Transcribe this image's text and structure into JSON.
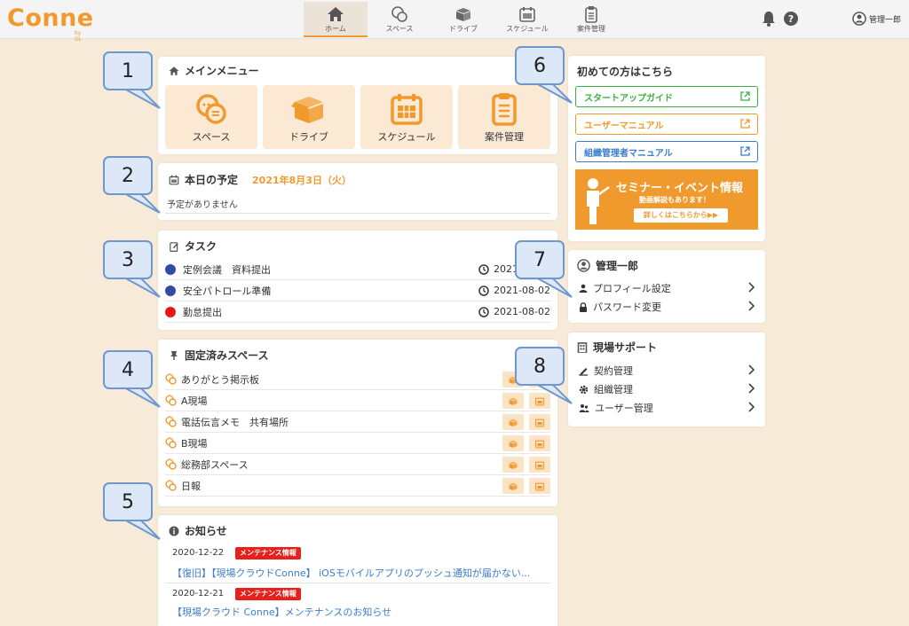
{
  "header": {
    "logo": "Conne",
    "logo_sub": "by GL",
    "nav": [
      {
        "label": "ホーム",
        "icon": "home-icon"
      },
      {
        "label": "スペース",
        "icon": "chat-icon"
      },
      {
        "label": "ドライブ",
        "icon": "box-icon"
      },
      {
        "label": "スケジュール",
        "icon": "calendar-icon"
      },
      {
        "label": "案件管理",
        "icon": "clipboard-icon"
      }
    ],
    "user": "管理一郎"
  },
  "main_menu": {
    "title": "メインメニュー",
    "tiles": [
      {
        "label": "スペース",
        "icon": "chat-icon"
      },
      {
        "label": "ドライブ",
        "icon": "box-icon"
      },
      {
        "label": "スケジュール",
        "icon": "calendar-icon"
      },
      {
        "label": "案件管理",
        "icon": "clipboard-icon"
      }
    ]
  },
  "today": {
    "title": "本日の予定",
    "date": "2021年8月3日（火）",
    "empty": "予定がありません"
  },
  "tasks": {
    "title": "タスク",
    "items": [
      {
        "label": "定例会議　資料提出",
        "due": "2021",
        "color": "#2f4ba3"
      },
      {
        "label": "安全パトロール準備",
        "due": "2021-08-02",
        "color": "#2f4ba3"
      },
      {
        "label": "勤怠提出",
        "due": "2021-08-02",
        "color": "#e81818"
      }
    ]
  },
  "pinned": {
    "title": "固定済みスペース",
    "items": [
      {
        "label": "ありがとう掲示板"
      },
      {
        "label": "A現場"
      },
      {
        "label": "電話伝言メモ　共有場所"
      },
      {
        "label": "B現場"
      },
      {
        "label": "総務部スペース"
      },
      {
        "label": "日報"
      }
    ]
  },
  "news": {
    "title": "お知らせ",
    "items": [
      {
        "date": "2020-12-22",
        "badge": "メンテナンス情報",
        "text": "【復旧】【現場クラウドConne】 iOSモバイルアプリのプッシュ通知が届かない..."
      },
      {
        "date": "2020-12-21",
        "badge": "メンテナンス情報",
        "text": "【現場クラウド Conne】メンテナンスのお知らせ"
      }
    ]
  },
  "guide": {
    "title": "初めての方はこちら",
    "buttons": [
      {
        "label": "スタートアップガイド",
        "color": "#3cb043"
      },
      {
        "label": "ユーザーマニュアル",
        "color": "#f09a2e"
      },
      {
        "label": "組織管理者マニュアル",
        "color": "#3b7dc9"
      }
    ],
    "banner": {
      "title": "セミナー・イベント情報",
      "sub": "動画解説もあります！",
      "button": "詳しくはこちらから▶▶"
    }
  },
  "account": {
    "name": "管理一郎",
    "items": [
      {
        "label": "プロフィール設定",
        "icon": "person-icon"
      },
      {
        "label": "パスワード変更",
        "icon": "lock-icon"
      }
    ]
  },
  "support": {
    "title": "現場サポート",
    "items": [
      {
        "label": "契約管理",
        "icon": "pen-icon"
      },
      {
        "label": "組織管理",
        "icon": "gear-icon"
      },
      {
        "label": "ユーザー管理",
        "icon": "users-icon"
      }
    ]
  },
  "callouts": [
    "1",
    "2",
    "3",
    "4",
    "5",
    "6",
    "7",
    "8"
  ],
  "colors": {
    "accent": "#f09a2e",
    "background": "#f7ead8",
    "callout_fill": "#dce8f7",
    "callout_border": "#6f97cc"
  }
}
